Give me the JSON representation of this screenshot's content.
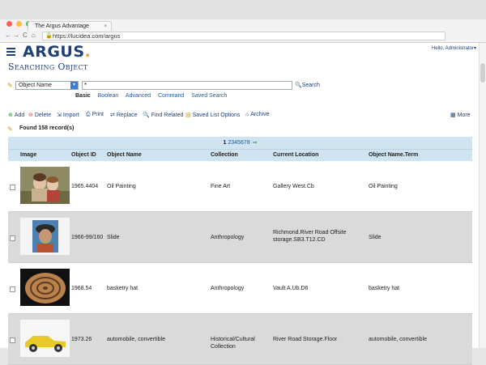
{
  "browser": {
    "tab_title": "The Argus Advantage",
    "tab_close": "×",
    "url": "https://lucidea.com/argus",
    "nav": {
      "back": "←",
      "forward": "→",
      "reload": "C",
      "home": "⌂"
    }
  },
  "app": {
    "logo_text": "ARGUS",
    "logo_dot": ".",
    "page_title": "Searching Object",
    "user": "Hello, Administrator▾"
  },
  "search": {
    "field": "Object Name",
    "value": "*",
    "button": "Search",
    "modes": [
      "Basic",
      "Boolean",
      "Advanced",
      "Command",
      "Saved Search"
    ]
  },
  "toolbar": {
    "add": "Add",
    "delete": "Delete",
    "import": "Import",
    "print": "Print",
    "replace": "Replace",
    "find_related": "Find Related",
    "saved_list": "Saved List Options",
    "archive": "Archive",
    "more": "More"
  },
  "results": {
    "found": "Found 158 record(s)",
    "pager_current": "1",
    "pager_pages": "2345678",
    "pager_next": "⇒",
    "columns": [
      "Image",
      "Object ID",
      "Object Name",
      "Collection",
      "Current Location",
      "Object Name.Term"
    ],
    "rows": [
      {
        "id": "1965.4404",
        "name": "Oil Painting",
        "collection": "Fine Art",
        "location": "Gallery West.Cb",
        "term": "Oil Painting"
      },
      {
        "id": "1966-99/160",
        "name": "Slide",
        "collection": "Anthropology",
        "location": "Richmond.River Road Offsite storage.SB3.T12.CD",
        "term": "Slide"
      },
      {
        "id": "1968.54",
        "name": "basketry hat",
        "collection": "Anthropology",
        "location": "Vault A.Ub.D6",
        "term": "basketry hat"
      },
      {
        "id": "1973.26",
        "name": "automobile, convertible",
        "collection": "Historical/Cultural Collection",
        "location": "River Road Storage.Floor",
        "term": "automobile, convertible"
      }
    ]
  },
  "colors": {
    "brand": "#1d3f7a",
    "accent": "#f0a01d",
    "header_bg": "#cfe3f1",
    "alt_row": "#dadada"
  }
}
